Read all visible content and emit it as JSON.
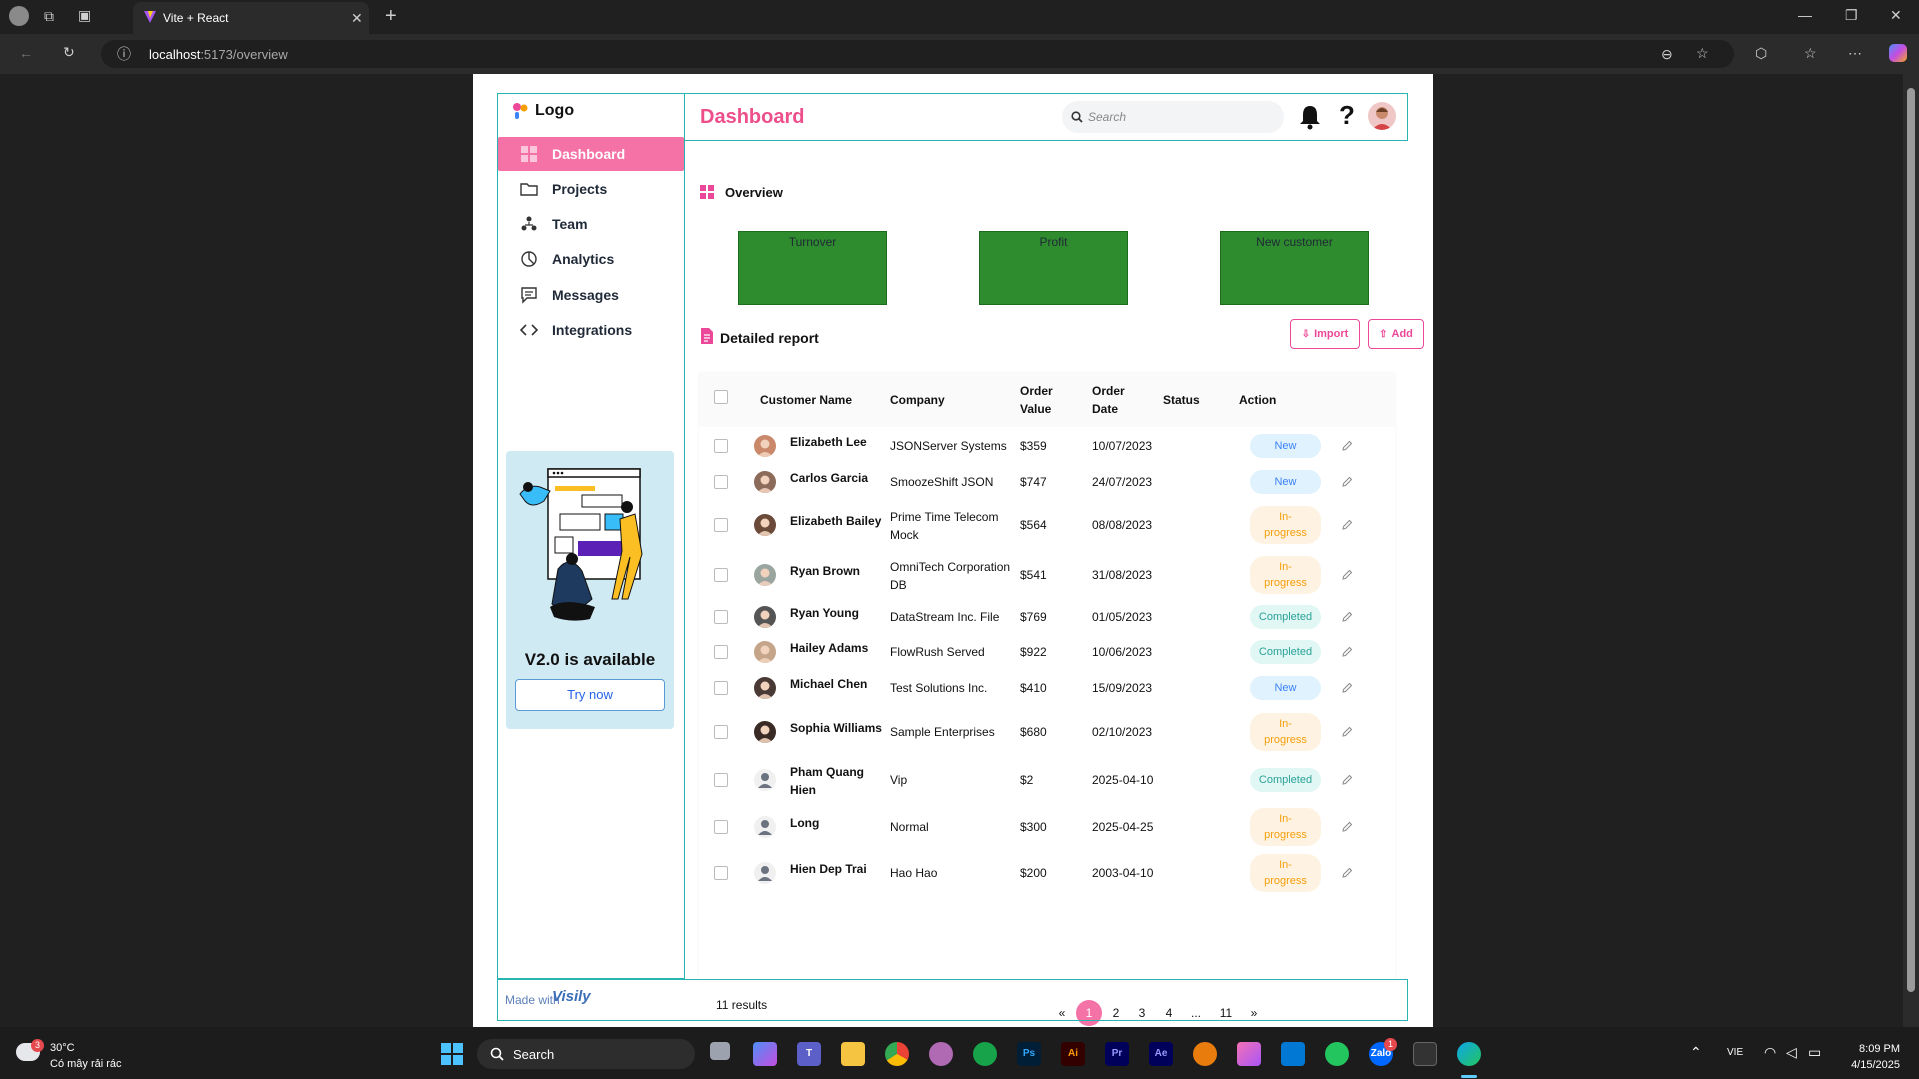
{
  "browser": {
    "tab_title": "Vite + React",
    "url_host": "localhost",
    "url_path": ":5173/overview"
  },
  "sidebar": {
    "logo_text": "Logo",
    "items": [
      {
        "label": "Dashboard",
        "icon": "dashboard-icon",
        "active": true
      },
      {
        "label": "Projects",
        "icon": "folder-icon"
      },
      {
        "label": "Team",
        "icon": "team-icon"
      },
      {
        "label": "Analytics",
        "icon": "pie-chart-icon"
      },
      {
        "label": "Messages",
        "icon": "message-icon"
      },
      {
        "label": "Integrations",
        "icon": "code-icon"
      }
    ],
    "promo": {
      "title": "V2.0 is available",
      "button": "Try now"
    }
  },
  "header": {
    "title": "Dashboard",
    "search_placeholder": "Search"
  },
  "overview": {
    "title": "Overview",
    "cards": [
      "Turnover",
      "Profit",
      "New customer"
    ],
    "card_color": "#2e8b2e"
  },
  "report": {
    "title": "Detailed report",
    "import_label": "Import",
    "add_label": "Add",
    "columns": [
      "Customer Name",
      "Company",
      "Order\nValue",
      "Order\nDate",
      "Status",
      "Action"
    ],
    "rows": [
      {
        "name": "Elizabeth Lee",
        "company": "JSONServer Systems",
        "value": "$359",
        "date": "10/07/2023",
        "status": "New"
      },
      {
        "name": "Carlos Garcia",
        "company": "SmoozeShift JSON",
        "value": "$747",
        "date": "24/07/2023",
        "status": "New"
      },
      {
        "name": "Elizabeth Bailey",
        "company": "Prime Time Telecom\nMock",
        "value": "$564",
        "date": "08/08/2023",
        "status": "In-\nprogress"
      },
      {
        "name": "Ryan Brown",
        "company": "OmniTech Corporation\nDB",
        "value": "$541",
        "date": "31/08/2023",
        "status": "In-\nprogress"
      },
      {
        "name": "Ryan Young",
        "company": "DataStream Inc. File",
        "value": "$769",
        "date": "01/05/2023",
        "status": "Completed"
      },
      {
        "name": "Hailey Adams",
        "company": "FlowRush Served",
        "value": "$922",
        "date": "10/06/2023",
        "status": "Completed"
      },
      {
        "name": "Michael Chen",
        "company": "Test Solutions Inc.",
        "value": "$410",
        "date": "15/09/2023",
        "status": "New"
      },
      {
        "name": "Sophia Williams",
        "company": "Sample Enterprises",
        "value": "$680",
        "date": "02/10/2023",
        "status": "In-\nprogress"
      },
      {
        "name": "Pham Quang\nHien",
        "company": "Vip",
        "value": "$2",
        "date": "2025-04-10",
        "status": "Completed"
      },
      {
        "name": "Long",
        "company": "Normal",
        "value": "$300",
        "date": "2025-04-25",
        "status": "In-\nprogress"
      },
      {
        "name": "Hien Dep Trai",
        "company": "Hao Hao",
        "value": "$200",
        "date": "2003-04-10",
        "status": "In-\nprogress"
      }
    ],
    "results": "11 results",
    "pages": [
      "«",
      "1",
      "2",
      "3",
      "4",
      "...",
      "11",
      "»"
    ],
    "current_page": "1"
  },
  "footer": {
    "made_with": "Made with",
    "brand": "Visily"
  },
  "taskbar": {
    "weather_temp": "30°C",
    "weather_desc": "Có mây rải rác",
    "weather_badge": "3",
    "search_label": "Search",
    "lang": "VIE",
    "time": "8:09 PM",
    "date": "4/15/2025",
    "zalo_badge": "1"
  }
}
